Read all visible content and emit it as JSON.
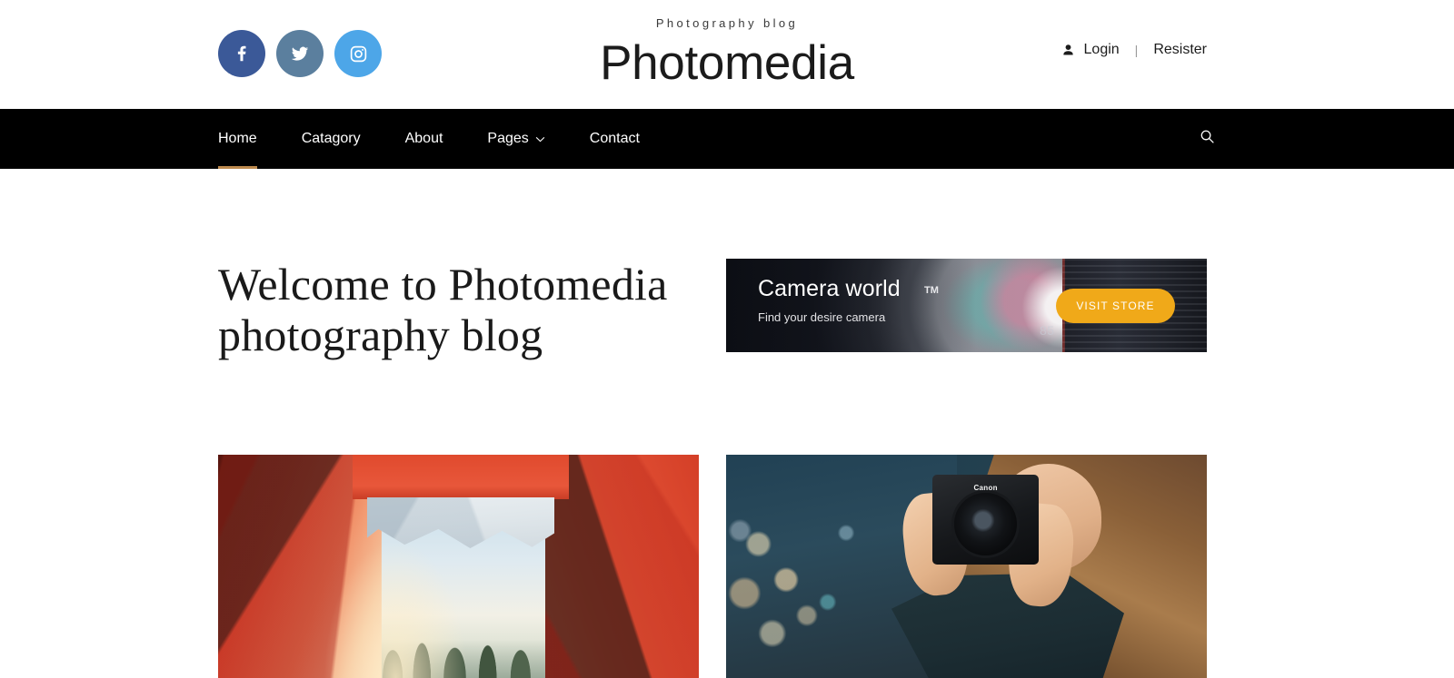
{
  "site": {
    "tagline": "Photography blog",
    "title": "Photomedia"
  },
  "social": [
    {
      "name": "facebook",
      "label": "Facebook",
      "color": "#3b5998"
    },
    {
      "name": "twitter",
      "label": "Twitter",
      "color": "#5b7f9e"
    },
    {
      "name": "instagram",
      "label": "Instagram",
      "color": "#4da6e8"
    }
  ],
  "account": {
    "user_icon": "user-icon",
    "login_label": "Login",
    "separator": "|",
    "register_label": "Resister"
  },
  "nav": {
    "items": [
      {
        "label": "Home",
        "active": true,
        "caret": false
      },
      {
        "label": "Catagory",
        "active": false,
        "caret": false
      },
      {
        "label": "About",
        "active": false,
        "caret": false
      },
      {
        "label": "Pages",
        "active": false,
        "caret": true
      },
      {
        "label": "Contact",
        "active": false,
        "caret": false
      }
    ],
    "search_icon": "search-icon",
    "active_underline_color": "#bd8a4e",
    "background_color": "#000000"
  },
  "hero": {
    "heading": "Welcome to Photomedia photography blog"
  },
  "banner": {
    "title": "Camera world",
    "trademark": "TM",
    "subtitle": "Find your desire camera",
    "cta_label": "VISIT STORE",
    "cta_color": "#f0a919",
    "lens_marking": "85"
  },
  "cards": [
    {
      "name": "tent-sunrise-photo",
      "alt": "View from inside a red camping tent looking out at sky and trees"
    },
    {
      "name": "photographer-camera-photo",
      "alt": "Woman holding a Canon DSLR camera with city bokeh lights behind"
    }
  ],
  "camera_brand": "Canon"
}
